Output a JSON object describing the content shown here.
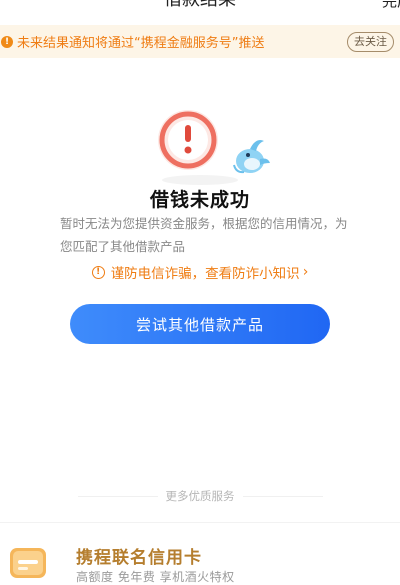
{
  "header": {
    "title": "借款结果",
    "done_label": "完成"
  },
  "notice": {
    "text": "未来结果通知将通过“携程金融服务号”推送",
    "follow_label": "去关注",
    "color": "#ef7d14"
  },
  "result": {
    "title": "借钱未成功",
    "description": "暂时无法为您提供资金服务，根据您的信用情况，为您匹配了其他借款产品",
    "anti_fraud": "谨防电信诈骗，查看防诈小知识"
  },
  "primary_button": {
    "label": "尝试其他借款产品",
    "color": "#2f78f7"
  },
  "more_section": {
    "label": "更多优质服务"
  },
  "card": {
    "title": "携程联名信用卡",
    "subtitle": "高额度 免年费 享机酒火特权",
    "title_color": "#b57e2e"
  },
  "icons": [
    "info-icon",
    "error-illustration-icon",
    "dolphin-mascot-icon",
    "chevron-right-icon",
    "credit-card-icon"
  ]
}
